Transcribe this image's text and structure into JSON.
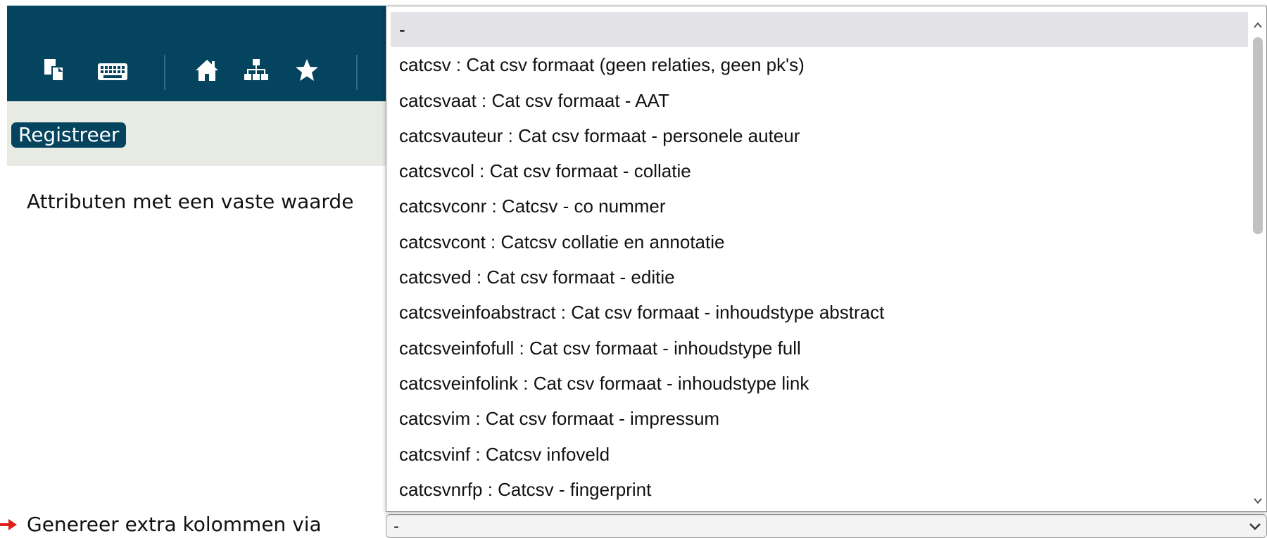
{
  "toolbar": {
    "icons": [
      "copy-icon",
      "keyboard-icon",
      "home-icon",
      "sitemap-icon",
      "star-icon"
    ],
    "background_color": "#04445f"
  },
  "register_button": {
    "label": "Registreer"
  },
  "form": {
    "fixed_attributes_label": "Attributen met een vaste waarde",
    "extra_columns_label": "Genereer extra kolommen via",
    "extra_columns_select_value": "-"
  },
  "dropdown": {
    "options": [
      "-",
      "catcsv : Cat csv formaat (geen relaties, geen pk's)",
      "catcsvaat : Cat csv formaat - AAT",
      "catcsvauteur : Cat csv formaat - personele auteur",
      "catcsvcol : Cat csv formaat - collatie",
      "catcsvconr : Catcsv - co nummer",
      "catcsvcont : Catcsv collatie en annotatie",
      "catcsved : Cat csv formaat - editie",
      "catcsveinfoabstract : Cat csv formaat - inhoudstype abstract",
      "catcsveinfofull : Cat csv formaat - inhoudstype full",
      "catcsveinfolink : Cat csv formaat - inhoudstype link",
      "catcsvim : Cat csv formaat - impressum",
      "catcsvinf : Catcsv infoveld",
      "catcsvnrfp : Catcsv - fingerprint"
    ],
    "highlighted_index": 0
  },
  "colors": {
    "accent": "#04445f",
    "subbar": "#e7ebe4",
    "required_marker": "#e0201b"
  }
}
